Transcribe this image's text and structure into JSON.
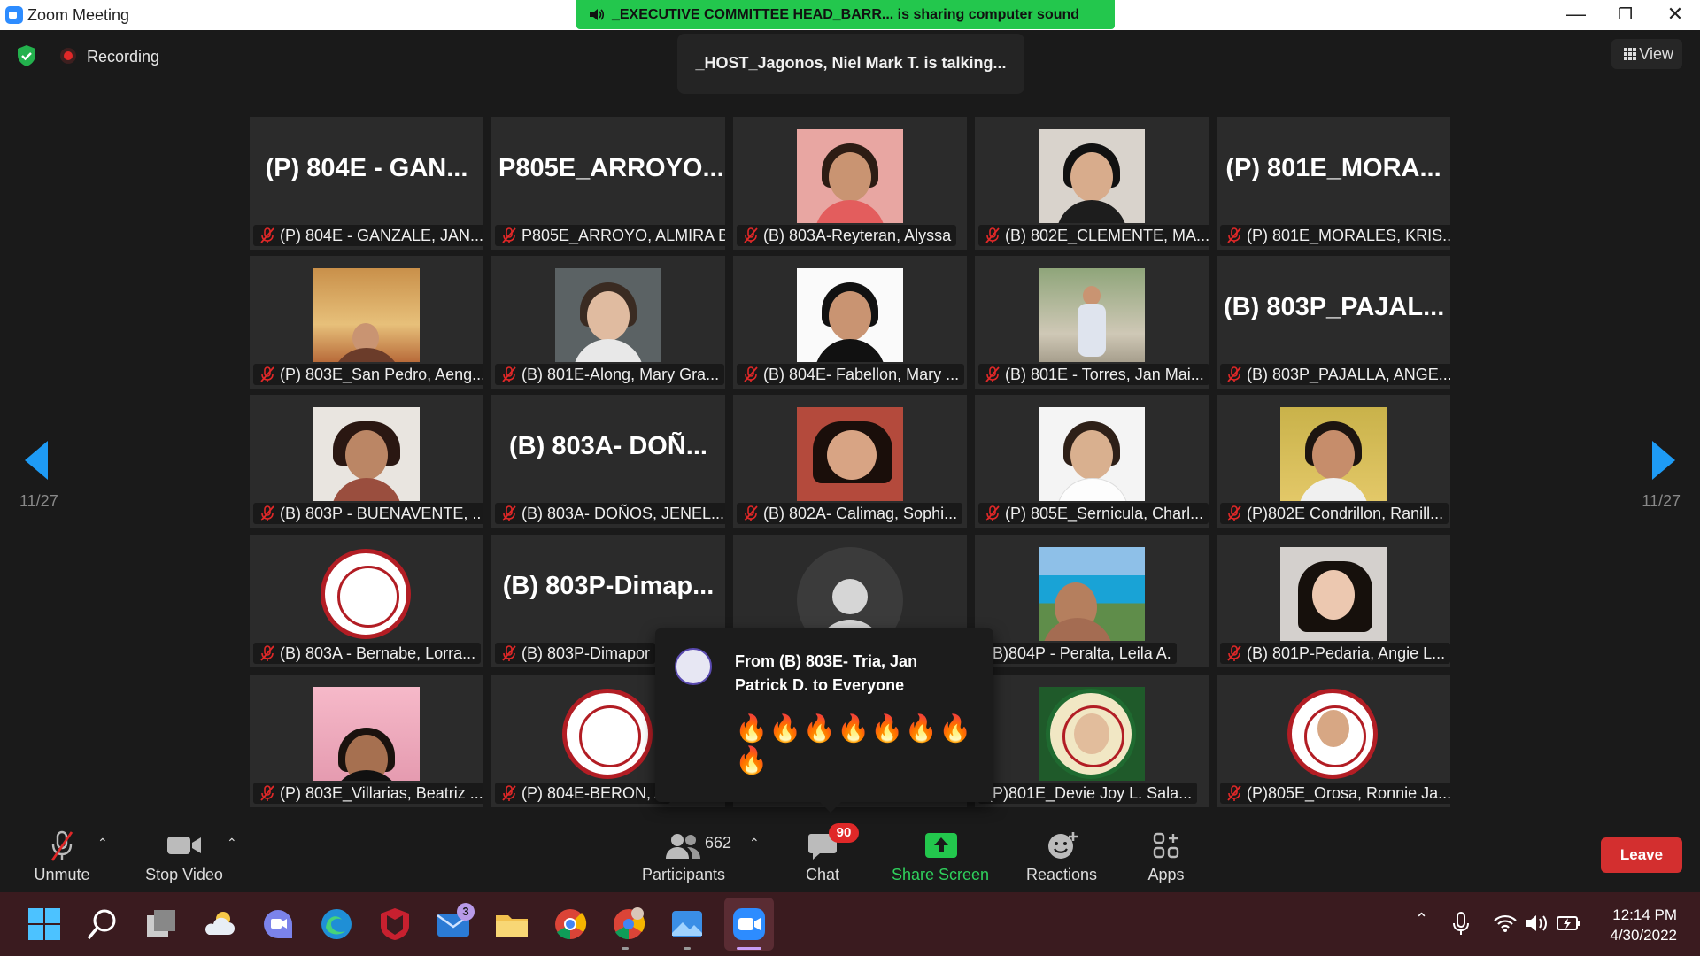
{
  "window": {
    "title": "Zoom Meeting"
  },
  "share_banner": "_EXECUTIVE COMMITTEE HEAD_BARR... is sharing computer sound",
  "topbar": {
    "recording": "Recording",
    "talking": "_HOST_Jagonos, Niel Mark T. is talking...",
    "view": "View"
  },
  "pager": {
    "left": "11/27",
    "right": "11/27"
  },
  "tiles": [
    {
      "big": "(P) 804E - GAN...",
      "name": "(P) 804E - GANZALE, JAN...",
      "muted": true
    },
    {
      "big": "P805E_ARROYO...",
      "name": "P805E_ARROYO, ALMIRA B.",
      "muted": true
    },
    {
      "name": "(B) 803A-Reyteran, Alyssa",
      "muted": true
    },
    {
      "name": "(B) 802E_CLEMENTE, MA...",
      "muted": true
    },
    {
      "big": "(P) 801E_MORA...",
      "name": "(P) 801E_MORALES, KRIS...",
      "muted": true
    },
    {
      "name": "(P) 803E_San Pedro, Aeng...",
      "muted": true
    },
    {
      "name": "(B) 801E-Along, Mary Gra...",
      "muted": true
    },
    {
      "name": "(B) 804E- Fabellon, Mary ...",
      "muted": true
    },
    {
      "name": "(B) 801E - Torres, Jan Mai...",
      "muted": true
    },
    {
      "big": "(B) 803P_PAJAL...",
      "name": "(B) 803P_PAJALLA, ANGE...",
      "muted": true
    },
    {
      "name": "(B) 803P - BUENAVENTE, ...",
      "muted": true
    },
    {
      "big": "(B) 803A- DOÑ...",
      "name": "(B) 803A- DOÑOS, JENEL...",
      "muted": true
    },
    {
      "name": "(B) 802A- Calimag, Sophi...",
      "muted": true
    },
    {
      "name": "(P) 805E_Sernicula, Charl...",
      "muted": true
    },
    {
      "name": "(P)802E Condrillon, Ranill...",
      "muted": true
    },
    {
      "name": "(B) 803A - Bernabe, Lorra...",
      "muted": true
    },
    {
      "big": "(B) 803P-Dimap...",
      "name": "(B) 803P-Dimapor",
      "muted": true
    },
    {
      "name": "",
      "muted": false
    },
    {
      "name": "(B)804P - Peralta, Leila A.",
      "muted": false
    },
    {
      "name": "(B) 801P-Pedaria, Angie L...",
      "muted": true
    },
    {
      "name": "(P) 803E_Villarias, Beatriz ...",
      "muted": true
    },
    {
      "name": "(P) 804E-BERON, A",
      "muted": true
    },
    {
      "name": "",
      "muted": false
    },
    {
      "name": "(P)801E_Devie Joy L. Sala...",
      "muted": false
    },
    {
      "name": "(P)805E_Orosa, Ronnie Ja...",
      "muted": true
    }
  ],
  "chat_popup": {
    "from": "From (B) 803E- Tria, Jan Patrick D. to Everyone",
    "message": "🔥🔥🔥🔥🔥🔥🔥🔥"
  },
  "toolbar": {
    "unmute": "Unmute",
    "stop_video": "Stop Video",
    "participants": "Participants",
    "participants_count": "662",
    "chat": "Chat",
    "chat_badge": "90",
    "share": "Share Screen",
    "reactions": "Reactions",
    "apps": "Apps",
    "leave": "Leave"
  },
  "taskbar": {
    "mail_badge": "3",
    "time": "12:14 PM",
    "date": "4/30/2022"
  },
  "colors": {
    "accent": "#2D8CFF",
    "share_green": "#23C74D",
    "leave_red": "#D32F2F",
    "mute_red": "#E02828"
  }
}
